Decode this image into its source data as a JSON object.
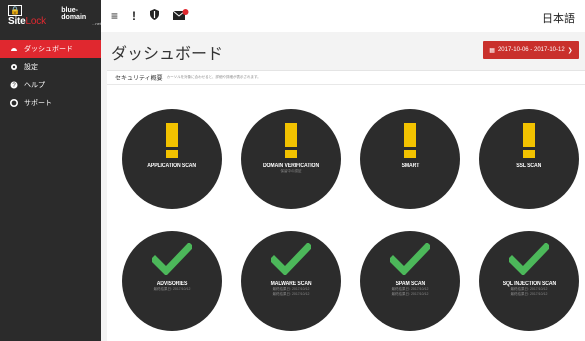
{
  "logo": {
    "brand_site": "Site",
    "brand_lock": "Lock",
    "partner": "blue-domain",
    "partner_sub": "...net"
  },
  "sidebar": {
    "items": [
      {
        "label": "ダッシュボード",
        "icon": "dashboard-icon"
      },
      {
        "label": "設定",
        "icon": "gear-icon"
      },
      {
        "label": "ヘルプ",
        "icon": "help-icon"
      },
      {
        "label": "サポート",
        "icon": "support-icon"
      }
    ]
  },
  "topbar": {
    "menu_icon": "menu-icon",
    "alert_icon": "alert-icon",
    "shield_icon": "shield-icon",
    "mail_icon": "mail-icon",
    "language": "日本語"
  },
  "page": {
    "title": "ダッシュボード",
    "date_range": "2017-10-06 - 2017-10-12"
  },
  "panel": {
    "heading": "セキュリティ概要",
    "note": "カーソルを対象に合わせると、詳細や詳細が表示されます。"
  },
  "scans_row1": [
    {
      "title": "APPLICATION SCAN",
      "sub": "",
      "status": "warning"
    },
    {
      "title": "DOMAIN VERIFICATION",
      "sub": "保留中の認証",
      "status": "warning"
    },
    {
      "title": "SMART",
      "sub": "",
      "status": "warning"
    },
    {
      "title": "SSL SCAN",
      "sub": "",
      "status": "warning"
    }
  ],
  "scans_row2": [
    {
      "title": "ADVISORIES",
      "sub": "最終結果日: 2017/10/12",
      "sub2": "",
      "status": "ok"
    },
    {
      "title": "MALWARE SCAN",
      "sub": "最終結果日: 2017/10/12",
      "sub2": "最終結果日: 2017/10/12",
      "status": "ok"
    },
    {
      "title": "SPAM SCAN",
      "sub": "最終結果日: 2017/10/12",
      "sub2": "最終結果日: 2017/10/12",
      "status": "ok"
    },
    {
      "title": "SQL INJECTION SCAN",
      "sub": "最終結果日: 2017/10/12",
      "sub2": "最終結果日: 2017/10/12",
      "status": "ok"
    }
  ],
  "colors": {
    "accent": "#e0282f",
    "warning": "#f2c200",
    "ok": "#4cb85a",
    "circle": "#2c2c2c"
  }
}
